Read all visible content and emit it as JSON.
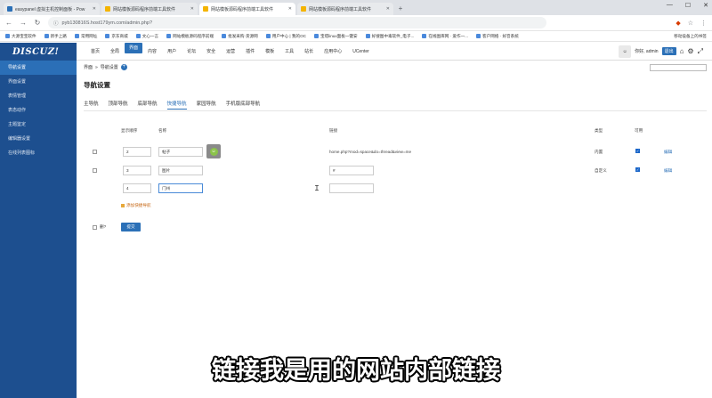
{
  "browser": {
    "tabs": [
      {
        "label": "easypanel 虚拟主机控制面板 - Pow"
      },
      {
        "label": "网站模板源码程序前端工具软件"
      },
      {
        "label": "网站模板源码程序前端工具软件"
      },
      {
        "label": "网站模板源码程序前端工具软件"
      }
    ],
    "address": "pyb130816S.host179ym.com/admin.php?",
    "bookmarks": [
      "大源宝宝软件",
      "新手上路",
      "常用网址",
      "京东商城",
      "文心一言",
      "网站模板源码程序前端",
      "批发采购·货源网",
      "用户中心 | 我的OC",
      "宝塔linux面板一键安",
      "好搜图中毒软件_电子...",
      "在线图库网 · 爱作一...",
      "客户网络 · 好音系统"
    ],
    "bookmarks_right": "移动设备上的书签"
  },
  "app": {
    "logo": "DISCUZ!",
    "topnav": [
      "首页",
      "全局",
      "界面",
      "内容",
      "用户",
      "论坛",
      "安全",
      "运营",
      "插件",
      "模板",
      "工具",
      "站长",
      "应用中心",
      "UCenter"
    ],
    "active_nav": "界面",
    "user_greeting": "你好, admin",
    "quit_label": "退出"
  },
  "sidebar": {
    "items": [
      {
        "label": "导航设置",
        "active": true
      },
      {
        "label": "界面设置",
        "active": false
      },
      {
        "label": "表情管理",
        "active": false
      },
      {
        "label": "表态动作",
        "active": false
      },
      {
        "label": "主题鉴定",
        "active": false
      },
      {
        "label": "编辑器设置",
        "active": false
      },
      {
        "label": "在线列表图标",
        "active": false
      }
    ]
  },
  "main": {
    "breadcrumb_root": "界面",
    "breadcrumb_sep": "»",
    "breadcrumb_current": "导航设置",
    "page_title": "导航设置",
    "subtabs": [
      "主导航",
      "顶部导航",
      "底部导航",
      "快捷导航",
      "家园导航",
      "手机版底部导航"
    ],
    "active_subtab": "快捷导航",
    "table": {
      "headers": {
        "order": "显示顺序",
        "name": "名称",
        "link": "链接",
        "type": "类型",
        "enabled": "可用"
      },
      "rows": [
        {
          "order": "2",
          "name": "帖子",
          "link": "home.php?mod=space&do=thread&view=me",
          "type": "内置",
          "enabled": true,
          "edit": "编辑",
          "has_icon": true
        },
        {
          "order": "3",
          "name": "图片",
          "link": "#",
          "type": "自定义",
          "enabled": true,
          "edit": "编辑",
          "has_icon": false
        }
      ],
      "new_row": {
        "order": "4",
        "name": "门州",
        "link": ""
      }
    },
    "add_label": "添加快捷导航",
    "delete_label": "删?",
    "submit_label": "提交"
  },
  "caption": "链接我是用的网站内部链接",
  "colors": {
    "sidebar": "#1d4f8f",
    "accent": "#2b70b7"
  }
}
